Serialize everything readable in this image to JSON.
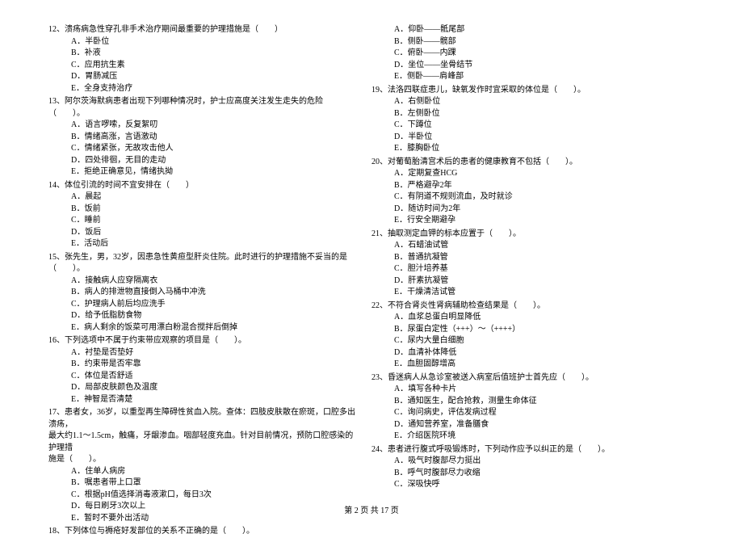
{
  "left_column": [
    {
      "number": "12、",
      "text": "溃疡病急性穿孔非手术治疗期间最重要的护理措施是（　　）",
      "options": [
        "A．半卧位",
        "B．补液",
        "C．应用抗生素",
        "D．胃肠减压",
        "E．全身支持治疗"
      ]
    },
    {
      "number": "13、",
      "text": "阿尔茨海默病患者出现下列哪种情况时，护士应高度关注发生走失的危险（　　）。",
      "options": [
        "A．语言啰嗦，反复絮叨",
        "B．情绪高涨，言语激动",
        "C．情绪紧张，无故攻击他人",
        "D．四处徘徊，无目的走动",
        "E．拒绝正确意见，情绪执拗"
      ]
    },
    {
      "number": "14、",
      "text": "体位引流的时间不宜安排在（　　）",
      "options": [
        "A．晨起",
        "B．饭前",
        "C．睡前",
        "D．饭后",
        "E．活动后"
      ]
    },
    {
      "number": "15、",
      "text": "张先生，男，32岁，因患急性黄疸型肝炎住院。此时进行的护理措施不妥当的是（　　）。",
      "options": [
        "A．接触病人应穿隔离衣",
        "B．病人的排泄物直接倒入马桶中冲洗",
        "C．护理病人前后均应洗手",
        "D．给予低脂肪食物",
        "E．病人剩余的饭菜可用漂白粉混合搅拌后倒掉"
      ]
    },
    {
      "number": "16、",
      "text": "下列选项中不属于约束带应观察的项目是（　　）。",
      "options": [
        "A．衬垫是否垫好",
        "B．约束带是否牢靠",
        "C．体位是否舒适",
        "D．局部皮肤颜色及温度",
        "E．神智是否清楚"
      ]
    },
    {
      "number": "17、",
      "text": "患者女，36岁，以重型再生障碍性贫血入院。查体：四肢皮肤散在瘀斑，口腔多出溃疡，",
      "sub_lines": [
        "最大约1.1～1.5cm，触痛，牙龈渗血。咽部轻度充血。针对目前情况，预防口腔感染的护理措",
        "施是（　　）。"
      ],
      "options": [
        "A．住单人病房",
        "B．嘱患者带上口罩",
        "C．根据pH值选择消毒液漱口，每日3次",
        "D．每日刷牙3次以上",
        "E．暂时不要外出活动"
      ]
    },
    {
      "number": "18、",
      "text": "下列体位与褥疮好发部位的关系不正确的是（　　）。",
      "options": []
    }
  ],
  "right_column_prefix_options": [
    "A．仰卧——骶尾部",
    "B．侧卧——髋部",
    "C．俯卧——内踝",
    "D．坐位——坐骨结节",
    "E．侧卧——肩峰部"
  ],
  "right_column": [
    {
      "number": "19、",
      "text": "法洛四联症患儿，缺氧发作时宜采取的体位是（　　）。",
      "options": [
        "A．右侧卧位",
        "B．左侧卧位",
        "C．下蹲位",
        "D．半卧位",
        "E．膝胸卧位"
      ]
    },
    {
      "number": "20、",
      "text": "对葡萄胎清宫术后的患者的健康教育不包括（　　）。",
      "options": [
        "A．定期复查HCG",
        "B．严格避孕2年",
        "C．有阴道不规则流血，及时就诊",
        "D．随访时间为2年",
        "E．行安全期避孕"
      ]
    },
    {
      "number": "21、",
      "text": "抽取测定血钾的标本应置于（　　）。",
      "options": [
        "A．石蜡油试管",
        "B．普通抗凝管",
        "C．胆汁培养基",
        "D．肝素抗凝管",
        "E．干燥清洁试管"
      ]
    },
    {
      "number": "22、",
      "text": "不符合肾炎性肾病辅助检查结果是（　　）。",
      "options": [
        "A．血浆总蛋白明显降低",
        "B．尿蛋白定性（+++）～（++++）",
        "C．尿内大量白细胞",
        "D．血清补体降低",
        "E．血胆固醇增高"
      ]
    },
    {
      "number": "23、",
      "text": "昏迷病人从急诊室被送入病室后值班护士首先应（　　）。",
      "options": [
        "A．填写各种卡片",
        "B．通知医生，配合抢救，测量生命体征",
        "C．询问病史，评估发病过程",
        "D．通知营养室，准备膳食",
        "E．介绍医院环境"
      ]
    },
    {
      "number": "24、",
      "text": "患者进行腹式呼吸锻炼时，下列动作应予以纠正的是（　　）。",
      "options": [
        "A．吸气时腹部尽力挺出",
        "B．呼气时腹部尽力收缩",
        "C．深吸快呼"
      ]
    }
  ],
  "footer": "第 2 页 共 17 页"
}
